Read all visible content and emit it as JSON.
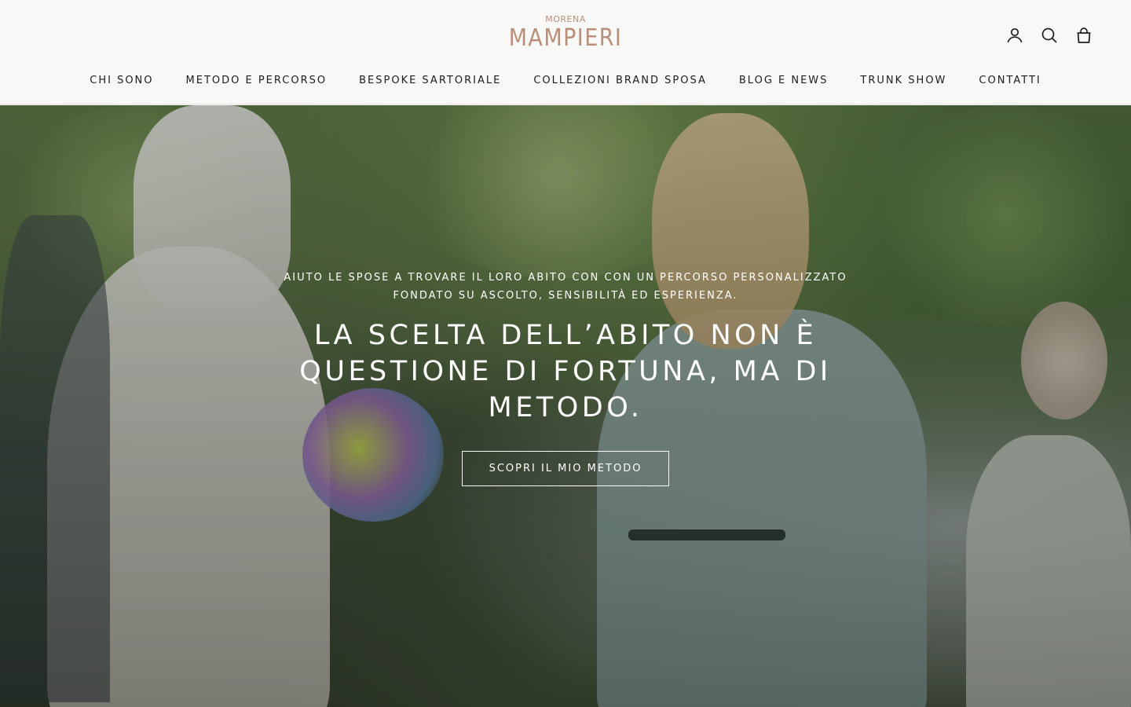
{
  "brand": {
    "logo_small": "MORENA",
    "logo_big": "MAMPIERI",
    "color": "#b98f79"
  },
  "header": {
    "icons": [
      "account-icon",
      "search-icon",
      "cart-icon"
    ]
  },
  "nav": {
    "items": [
      {
        "label": "CHI SONO"
      },
      {
        "label": "METODO E PERCORSO"
      },
      {
        "label": "BESPOKE SARTORIALE"
      },
      {
        "label": "COLLEZIONI BRAND SPOSA"
      },
      {
        "label": "BLOG E NEWS"
      },
      {
        "label": "TRUNK SHOW"
      },
      {
        "label": "CONTATTI"
      }
    ]
  },
  "hero": {
    "subtitle_line1": "AIUTO LE SPOSE A TROVARE IL LORO ABITO CON CON UN PERCORSO PERSONALIZZATO",
    "subtitle_line2": "FONDATO SU ASCOLTO, SENSIBILITÀ ED ESPERIENZA.",
    "title": "LA SCELTA DELL’ABITO NON È QUESTIONE DI FORTUNA, MA DI METODO.",
    "cta_label": "SCOPRI IL MIO METODO"
  }
}
